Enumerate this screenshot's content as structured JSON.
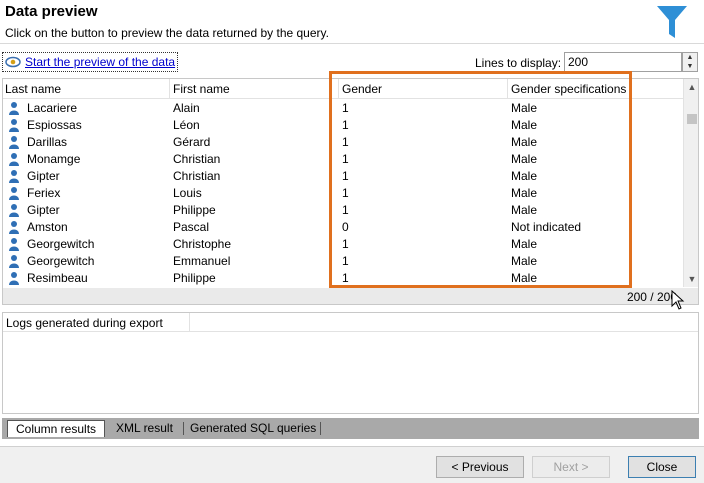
{
  "header": {
    "title": "Data preview",
    "subtitle": "Click on the button to preview the data returned by the query.",
    "icon": "funnel-icon",
    "icon_color": "#2e8fd6"
  },
  "toolbar": {
    "preview_link": "Start the preview of the data",
    "lines_label": "Lines to display:",
    "lines_value": "200"
  },
  "grid": {
    "columns": [
      "Last name",
      "First name",
      "Gender",
      "Gender specifications"
    ],
    "rows": [
      [
        "Lacariere",
        "Alain",
        "1",
        "Male"
      ],
      [
        "Espiossas",
        "Léon",
        "1",
        "Male"
      ],
      [
        "Darillas",
        "Gérard",
        "1",
        "Male"
      ],
      [
        "Monamge",
        "Christian",
        "1",
        "Male"
      ],
      [
        "Gipter",
        "Christian",
        "1",
        "Male"
      ],
      [
        "Feriex",
        "Louis",
        "1",
        "Male"
      ],
      [
        "Gipter",
        "Philippe",
        "1",
        "Male"
      ],
      [
        "Amston",
        "Pascal",
        "0",
        "Not indicated"
      ],
      [
        "Georgewitch",
        "Christophe",
        "1",
        "Male"
      ],
      [
        "Georgewitch",
        "Emmanuel",
        "1",
        "Male"
      ],
      [
        "Resimbeau",
        "Philippe",
        "1",
        "Male"
      ]
    ],
    "count": "200 / 200",
    "highlight_color": "#e0701e"
  },
  "logs": {
    "header": "Logs generated during export"
  },
  "tabs": [
    "Column results",
    "XML result",
    "Generated SQL queries"
  ],
  "footer": {
    "previous": "< Previous",
    "next": "Next >",
    "close": "Close"
  }
}
